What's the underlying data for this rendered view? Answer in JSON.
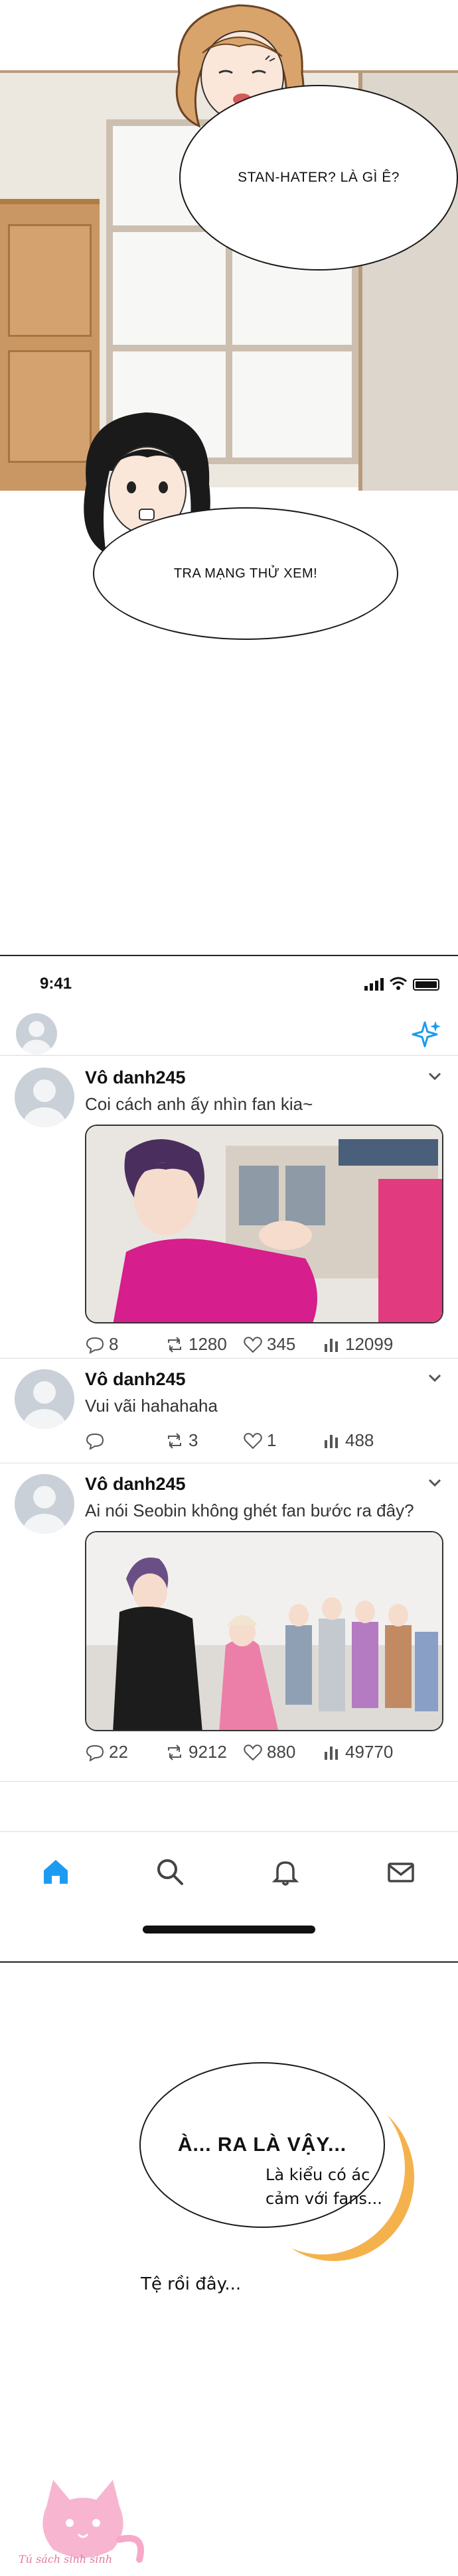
{
  "panel1": {
    "bubble_top": "STAN-HATER? LÀ GÌ Ê?",
    "bubble_bottom": "TRA MẠNG THỬ XEM!"
  },
  "phone": {
    "status": {
      "time": "9:41"
    },
    "icons": {
      "sparkle": "sparkle-icon",
      "home": "home-icon",
      "search": "search-icon",
      "bell": "bell-icon",
      "mail": "mail-icon"
    },
    "colors": {
      "accent": "#1d9bf0",
      "text_muted": "#444444",
      "divider": "#d8dde2"
    },
    "tweets": [
      {
        "name": "Vô danh245",
        "text": "Coi cách anh ấy nhìn fan kia~",
        "replies": "8",
        "retweets": "1280",
        "likes": "345",
        "views": "12099"
      },
      {
        "name": "Vô danh245",
        "text": "Vui vãi hahahaha",
        "replies": "",
        "retweets": "3",
        "likes": "1",
        "views": "488"
      },
      {
        "name": "Vô danh245",
        "text": "Ai nói Seobin không ghét fan bước ra đây?",
        "replies": "22",
        "retweets": "9212",
        "likes": "880",
        "views": "49770"
      }
    ]
  },
  "panel3": {
    "bubble": "À... RA LÀ VẬY...",
    "aside_line1": "Là kiểu có ác",
    "aside_line2": "cảm với fans...",
    "aside2": "Tệ rồi đây..."
  },
  "watermark": {
    "text": "Tú sách sinh sinh"
  }
}
